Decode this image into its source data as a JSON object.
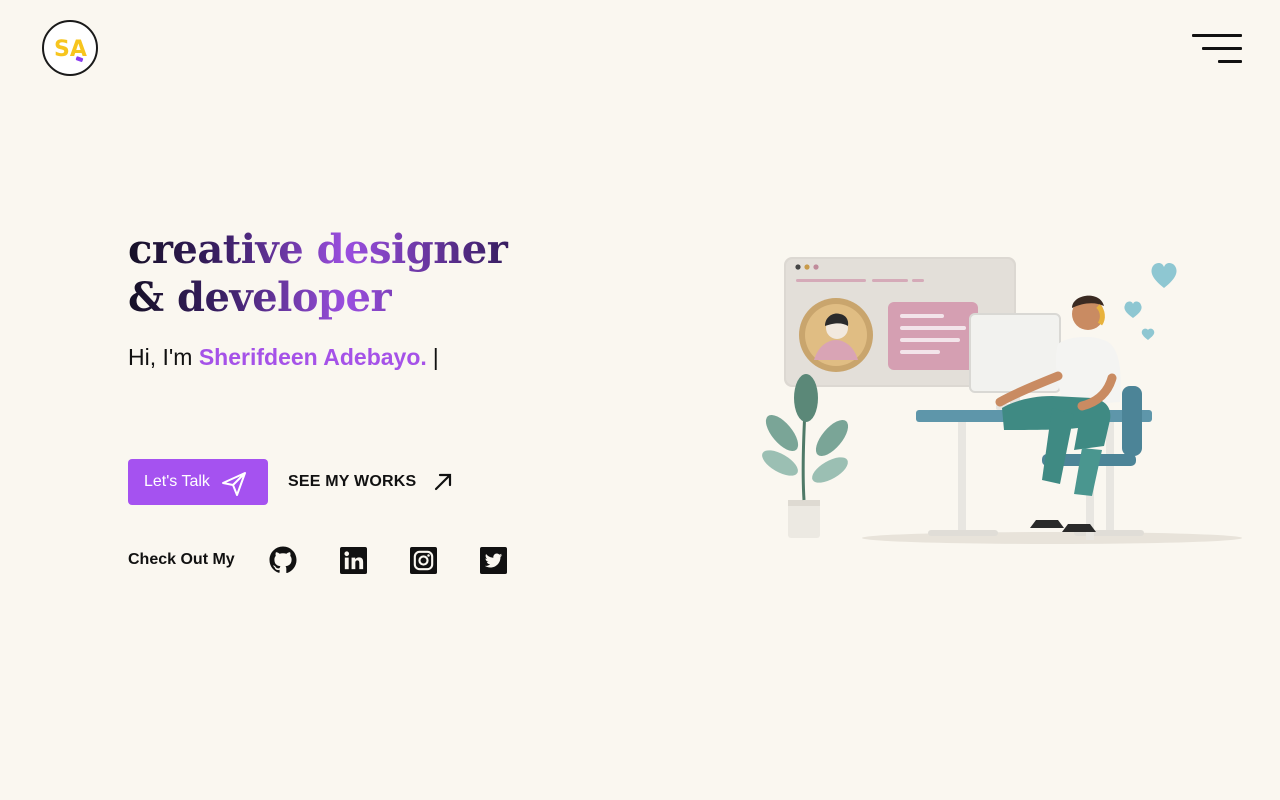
{
  "header": {
    "logo_text": "SA",
    "logo_icon": "sa-monogram-logo",
    "menu_icon": "hamburger-menu-icon"
  },
  "hero": {
    "headline_line1": "creative designer",
    "headline_line2": "& developer",
    "intro_prefix": "Hi, I'm ",
    "intro_name": "Sherifdeen Adebayo.",
    "intro_cursor": "|"
  },
  "actions": {
    "primary_label": "Let's Talk",
    "primary_icon": "paper-plane-icon",
    "secondary_label": "SEE MY WORKS",
    "secondary_icon": "arrow-up-right-icon"
  },
  "social": {
    "label": "Check Out My",
    "links": [
      {
        "name": "GitHub",
        "icon": "github-icon"
      },
      {
        "name": "LinkedIn",
        "icon": "linkedin-icon"
      },
      {
        "name": "Instagram",
        "icon": "instagram-icon"
      },
      {
        "name": "Twitter",
        "icon": "twitter-icon"
      }
    ]
  },
  "colors": {
    "background": "#faf7f0",
    "accent": "#a552f0",
    "text": "#111111",
    "logo_yellow": "#f7c51e"
  }
}
